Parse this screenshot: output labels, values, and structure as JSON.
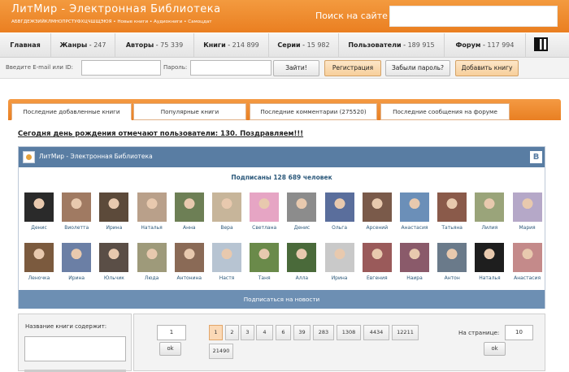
{
  "header": {
    "title": "ЛитМир - Электронная Библиотека",
    "alphabet": "АБВГДЕЖЗИЙКЛМНОПРСТУФХЦЧШЩЭЮЯ",
    "links": [
      "Новые книги",
      "Аудиокниги",
      "Самоцдат"
    ],
    "search_label": "Поиск на сайте",
    "search_value": ""
  },
  "nav": {
    "items": [
      {
        "label": "Главная",
        "count": ""
      },
      {
        "label": "Жанры",
        "count": "247"
      },
      {
        "label": "Авторы",
        "count": "75 339"
      },
      {
        "label": "Книги",
        "count": "214 899"
      },
      {
        "label": "Серии",
        "count": "15 982"
      },
      {
        "label": "Пользователи",
        "count": "189 915"
      },
      {
        "label": "Форум",
        "count": "117 994"
      }
    ],
    "qr_icon": "qr-code-icon"
  },
  "login": {
    "email_label": "Введите E-mail или ID:",
    "email_value": "",
    "password_label": "Пароль:",
    "password_value": "",
    "go_button": "Зайти!",
    "register_button": "Регистрация",
    "forgot_button": "Забыли пароль?",
    "add_book_button": "Добавить книгу"
  },
  "tabs": [
    "Последние добавленные книги",
    "Популярные книги",
    "Последние комментарии (275520)",
    "Последние сообщения на форуме"
  ],
  "birthday_text": "Сегодня день рождения отмечают пользователи: 130. Поздравляем!!!",
  "vk_widget": {
    "title": "ЛитМир - Электронная Библиотека",
    "brand_letter": "B",
    "subscribers": "Подписаны 128 689 человек",
    "subscribe_button": "Подписаться на новости",
    "members_row1": [
      "Денис",
      "Виолетта",
      "Ирина",
      "Наталья",
      "Анна",
      "Вера",
      "Светлана",
      "Денис",
      "Ольга",
      "Арсений",
      "Анастасия",
      "Татьяна",
      "Лилия",
      "Мария"
    ],
    "members_row2": [
      "Леночка",
      "Ирина",
      "Юльчик",
      "Люда",
      "Антонина",
      "Настя",
      "Таня",
      "Алла",
      "Ирина",
      "Евгения",
      "Наира",
      "Антон",
      "Наталья",
      "Анастасия"
    ]
  },
  "book_search": {
    "label": "Название книги содержит:",
    "value": ""
  },
  "pagination": {
    "jump_value": "1",
    "ok_label": "ok",
    "pages": [
      "1",
      "2",
      "3",
      "4",
      "6",
      "39",
      "283",
      "1308",
      "4434",
      "12211",
      "21490"
    ],
    "current_page": "1",
    "per_page_label": "На странице:",
    "per_page_value": "10",
    "per_page_ok": "ok"
  }
}
